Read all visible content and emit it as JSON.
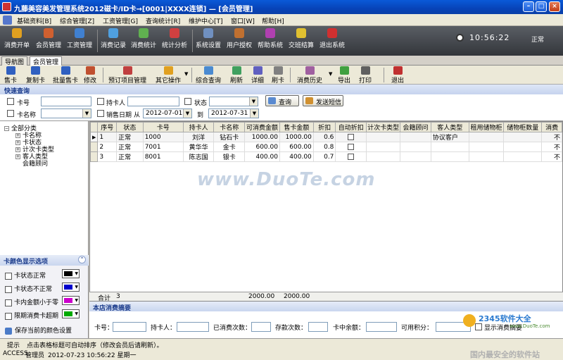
{
  "window": {
    "title": "九藤美容美发管理系统2012磁卡/ID卡→[0001|XXXX连锁] — [会员管理]"
  },
  "menu": [
    "基础资料[B]",
    "综合管理[Z]",
    "工资管理[G]",
    "查询统计[R]",
    "维护中心[T]",
    "窗口[W]",
    "帮助[H]"
  ],
  "toolbar": [
    {
      "label": "消费开单",
      "color": "#e0a020"
    },
    {
      "label": "会员管理",
      "color": "#d06030"
    },
    {
      "label": "工资管理",
      "color": "#4080d0"
    },
    {
      "label": "消费记录",
      "color": "#4fa0e0"
    },
    {
      "label": "消费统计",
      "color": "#60b050"
    },
    {
      "label": "统计分析",
      "color": "#d04040"
    },
    {
      "label": "系统设置",
      "color": "#7090c0"
    },
    {
      "label": "用户授权",
      "color": "#c07030"
    },
    {
      "label": "帮助系统",
      "color": "#b040b0"
    },
    {
      "label": "交班结算",
      "color": "#e0c030"
    },
    {
      "label": "退出系统",
      "color": "#d03030"
    }
  ],
  "clock": "10:56:22",
  "status": "正常",
  "tabs": [
    "导航图",
    "会员管理"
  ],
  "subtoolbar": [
    {
      "label": "售卡",
      "color": "#3060c0"
    },
    {
      "label": "复制卡",
      "color": "#3060c0"
    },
    {
      "label": "批量售卡",
      "color": "#3060c0"
    },
    {
      "label": "修改",
      "color": "#c05030"
    },
    {
      "label": "预订项目管理",
      "color": "#c04040"
    },
    {
      "label": "其它操作",
      "color": "#e0a020"
    },
    {
      "label": "综合查询",
      "color": "#4a8ad0"
    },
    {
      "label": "刷新",
      "color": "#40a060"
    },
    {
      "label": "详细",
      "color": "#6060c0"
    },
    {
      "label": "刷卡",
      "color": "#808080"
    },
    {
      "label": "消费历史",
      "color": "#a060a0"
    },
    {
      "label": "导出",
      "color": "#40a040"
    },
    {
      "label": "打印",
      "color": "#606060"
    },
    {
      "label": "退出",
      "color": "#c03030"
    }
  ],
  "query": {
    "title": "快速查询",
    "card_no_label": "卡号",
    "holder_label": "持卡人",
    "status_label": "状态",
    "card_name_label": "卡名称",
    "sale_date_label": "销售日期",
    "from_label": "从",
    "to_label": "到",
    "date_from": "2012-07-01",
    "date_to": "2012-07-31",
    "search_btn": "查询",
    "sms_btn": "发送短信"
  },
  "tree": {
    "root": "全部分类",
    "children": [
      "卡名称",
      "卡状态",
      "计次卡类型",
      "客人类型",
      "会籍顾问"
    ]
  },
  "color_options": {
    "title": "卡颜色显示选项",
    "rows": [
      {
        "label": "卡状态正常",
        "color": "#000000"
      },
      {
        "label": "卡状态不正常",
        "color": "#0000cc"
      },
      {
        "label": "卡内金额小于零",
        "color": "#cc00cc"
      },
      {
        "label": "限期消费卡超期",
        "color": "#00aa00"
      }
    ],
    "save": "保存当前的颜色设置"
  },
  "grid": {
    "columns": [
      "序号",
      "状态",
      "卡号",
      "持卡人",
      "卡名称",
      "可消费金额",
      "售卡金额",
      "折扣",
      "自动折扣",
      "计次卡类型",
      "会籍顾问",
      "客人类型",
      "租用储物柜",
      "储物柜数量",
      "消费"
    ],
    "rows": [
      {
        "seq": "1",
        "status": "正常",
        "card_no": "1000",
        "holder": "刘洋",
        "card_name": "钻石卡",
        "balance": "1000.00",
        "sale_amount": "1000.00",
        "discount": "0.6",
        "guest_type": "协议客户",
        "tail": "不"
      },
      {
        "seq": "2",
        "status": "正常",
        "card_no": "7001",
        "holder": "黄华华",
        "card_name": "金卡",
        "balance": "600.00",
        "sale_amount": "600.00",
        "discount": "0.8",
        "guest_type": "",
        "tail": "不"
      },
      {
        "seq": "3",
        "status": "正常",
        "card_no": "8001",
        "holder": "陈志国",
        "card_name": "银卡",
        "balance": "400.00",
        "sale_amount": "400.00",
        "discount": "0.7",
        "guest_type": "",
        "tail": "不"
      }
    ],
    "total_label": "合计",
    "total_count": "3",
    "total_balance": "2000.00",
    "total_sale": "2000.00"
  },
  "watermark": "www.DuoTe.com",
  "summary": {
    "title": "本店消费摘要",
    "card_no": "卡号：",
    "holder": "持卡人：",
    "consumed_count": "已消费次数：",
    "stored_count": "存款次数：",
    "balance": "卡中余额：",
    "points": "可用积分：",
    "show_summary": "显示消费摘要"
  },
  "statusbar": {
    "hint_label": "提示",
    "hint": "点击表格标题可自动排序（修改会员后请刷新）。",
    "db": "ACCESS",
    "user": "管理员",
    "datetime": "2012-07-23 10:56:22 星期一"
  },
  "site_mark": {
    "brand": "2345软件大全",
    "url": "www.DuoTe.com",
    "slogan": "国内最安全的软件站"
  }
}
